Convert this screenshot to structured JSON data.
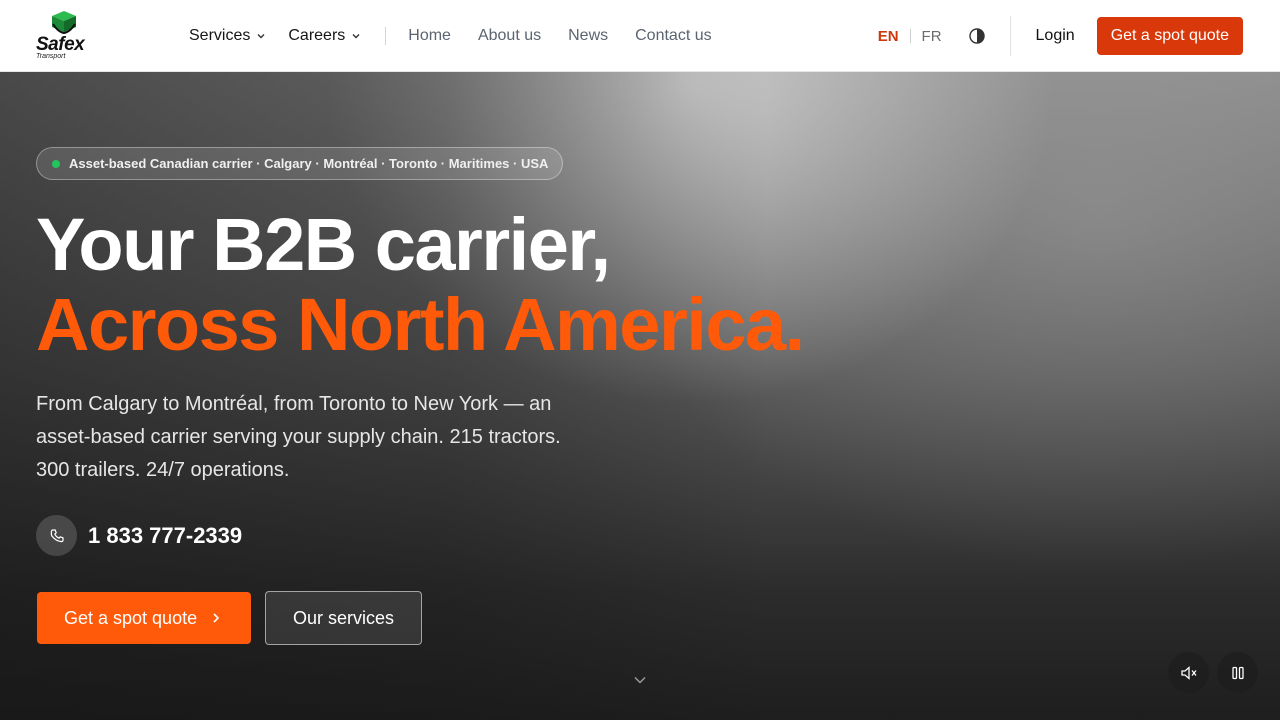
{
  "brand": {
    "name": "Safex",
    "tagline": "Transport",
    "green": "#1f9d3a"
  },
  "nav": {
    "dropdowns": [
      {
        "label": "Services"
      },
      {
        "label": "Careers"
      }
    ],
    "links": [
      {
        "label": "Home"
      },
      {
        "label": "About us"
      },
      {
        "label": "News"
      },
      {
        "label": "Contact us"
      }
    ],
    "languages": {
      "active": "EN",
      "other": "FR"
    },
    "theme_icon": "theme-toggle-icon",
    "login_label": "Login",
    "quote_label": "Get a spot quote"
  },
  "hero": {
    "badge": "Asset-based Canadian carrier · Calgary · Montréal · Toronto · Maritimes · USA",
    "title_line1": "Your B2B carrier,",
    "title_line2": "Across North America.",
    "lead": "From Calgary to Montréal, from Toronto to New York — an asset-based carrier serving your supply chain. 215 tractors. 300 trailers. 24/7 operations.",
    "phone": "1 833 777-2339",
    "cta_primary": "Get a spot quote",
    "cta_secondary": "Our services"
  },
  "colors": {
    "accent": "#ff5a0a",
    "accent_dark": "#d9380a",
    "status_dot": "#22c55e"
  },
  "media_controls": {
    "mute_icon": "volume-mute-icon",
    "pause_icon": "pause-icon"
  }
}
